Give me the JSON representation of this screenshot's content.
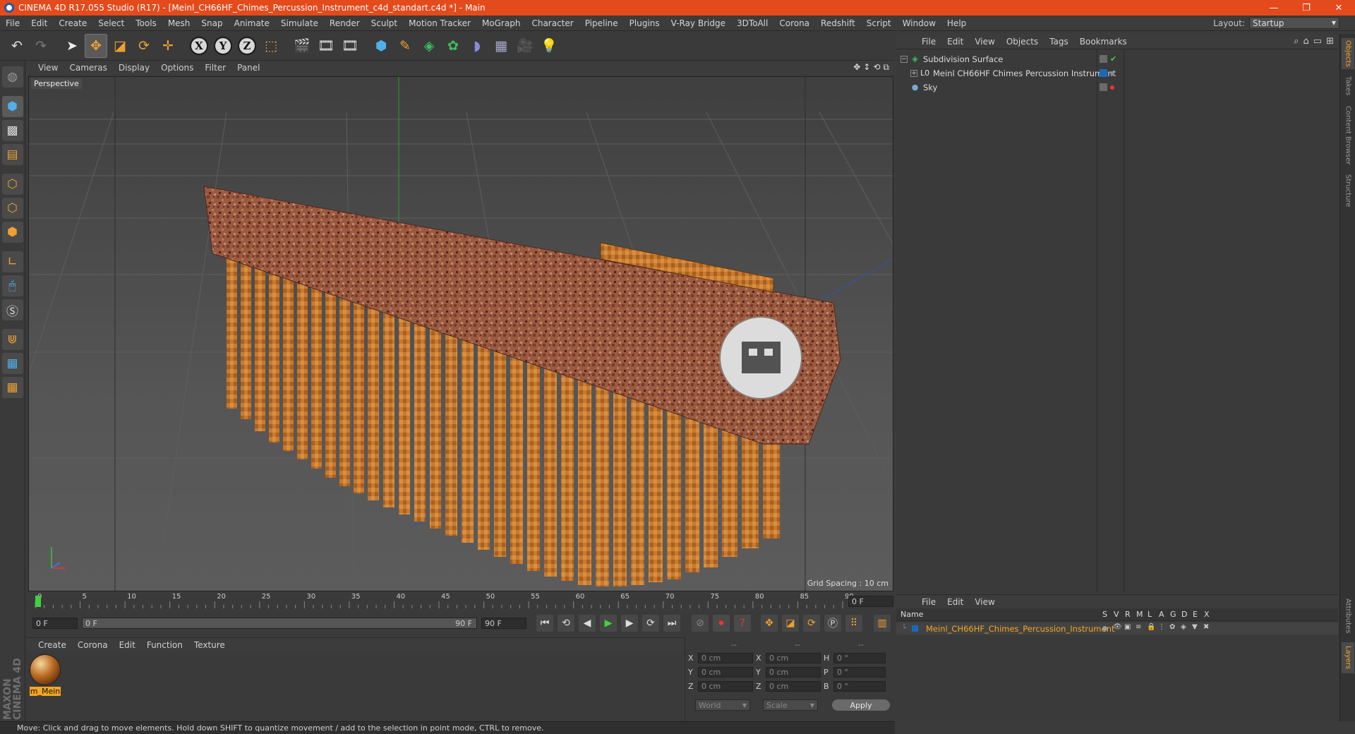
{
  "window": {
    "title": "CINEMA 4D R17.055 Studio (R17) - [Meinl_CH66HF_Chimes_Percussion_Instrument_c4d_standart.c4d *] - Main",
    "controls": [
      "—",
      "❐",
      "✕"
    ]
  },
  "menubar": {
    "items": [
      "File",
      "Edit",
      "Create",
      "Select",
      "Tools",
      "Mesh",
      "Snap",
      "Animate",
      "Simulate",
      "Render",
      "Sculpt",
      "Motion Tracker",
      "MoGraph",
      "Character",
      "Pipeline",
      "Plugins",
      "V-Ray Bridge",
      "3DToAll",
      "Corona",
      "Redshift",
      "Script",
      "Window",
      "Help"
    ],
    "layout_label": "Layout:",
    "layout_value": "Startup"
  },
  "toolbar": {
    "axis_labels": [
      "X",
      "Y",
      "Z"
    ]
  },
  "viewport": {
    "menu": [
      "View",
      "Cameras",
      "Display",
      "Options",
      "Filter",
      "Panel"
    ],
    "label": "Perspective",
    "grid_spacing": "Grid Spacing : 10 cm",
    "nav_icons": [
      "✥",
      "↕",
      "⟲",
      "⧉"
    ]
  },
  "timeline": {
    "ticks": [
      "0",
      "5",
      "10",
      "15",
      "20",
      "25",
      "30",
      "35",
      "40",
      "45",
      "50",
      "55",
      "60",
      "65",
      "70",
      "75",
      "80",
      "85",
      "90"
    ],
    "current_frame": "0 F",
    "start_field": "0 F",
    "range_start": "0 F",
    "range_end": "90 F",
    "end_field": "90 F"
  },
  "material_manager": {
    "menu": [
      "Create",
      "Corona",
      "Edit",
      "Function",
      "Texture"
    ],
    "material_name": "m_Mein"
  },
  "coordinates": {
    "headers": [
      "--",
      "--",
      "--"
    ],
    "rows": [
      {
        "a": "X",
        "v1": "0 cm",
        "b": "X",
        "v2": "0 cm",
        "c": "H",
        "v3": "0 °"
      },
      {
        "a": "Y",
        "v1": "0 cm",
        "b": "Y",
        "v2": "0 cm",
        "c": "P",
        "v3": "0 °"
      },
      {
        "a": "Z",
        "v1": "0 cm",
        "b": "Z",
        "v2": "0 cm",
        "c": "B",
        "v3": "0 °"
      }
    ],
    "world": "World",
    "scale": "Scale",
    "apply": "Apply"
  },
  "statusbar": {
    "text": "Move: Click and drag to move elements. Hold down SHIFT to quantize movement / add to the selection in point mode, CTRL to remove."
  },
  "brand": "MAXON CINEMA 4D",
  "object_manager": {
    "menu": [
      "File",
      "Edit",
      "View",
      "Objects",
      "Tags",
      "Bookmarks"
    ],
    "objects": [
      {
        "name": "Subdivision Surface",
        "icon": "subdivision-icon",
        "color": "#3fbf5f"
      },
      {
        "name": "Meinl CH66HF Chimes Percussion Instrument",
        "icon": "null-object-icon",
        "color": "#dddddd"
      },
      {
        "name": "Sky",
        "icon": "sky-icon",
        "color": "#7aa8d8"
      }
    ]
  },
  "right_tabs": [
    "Objects",
    "Takes",
    "Content Browser",
    "Structure",
    "Attributes",
    "Layers"
  ],
  "layer_manager": {
    "menu": [
      "File",
      "Edit",
      "View"
    ],
    "columns": [
      "Name",
      "S",
      "V",
      "R",
      "M",
      "L",
      "A",
      "G",
      "D",
      "E",
      "X"
    ],
    "layer_name": "Meinl_CH66HF_Chimes_Percussion_Instrument"
  }
}
